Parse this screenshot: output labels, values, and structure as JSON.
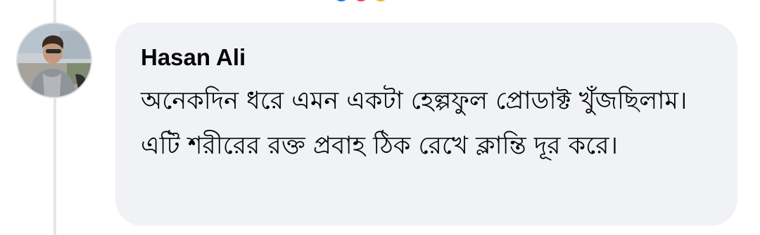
{
  "comment": {
    "author": "Hasan Ali",
    "text": "অনেকদিন ধরে এমন একটা হেল্পফুল প্রোডাক্ট খুঁজছিলাম। এটি শরীরের রক্ত প্রবাহ ঠিক রেখে ক্লান্তি দূর করে।",
    "avatar_icon": "profile-photo"
  },
  "previous_comment": {
    "reaction_colors": [
      "#1877f2",
      "#f33e58",
      "#f7b125"
    ]
  },
  "colors": {
    "bubble_background": "#f0f2f5",
    "text": "#050505",
    "thread_line": "#e4e6eb"
  }
}
